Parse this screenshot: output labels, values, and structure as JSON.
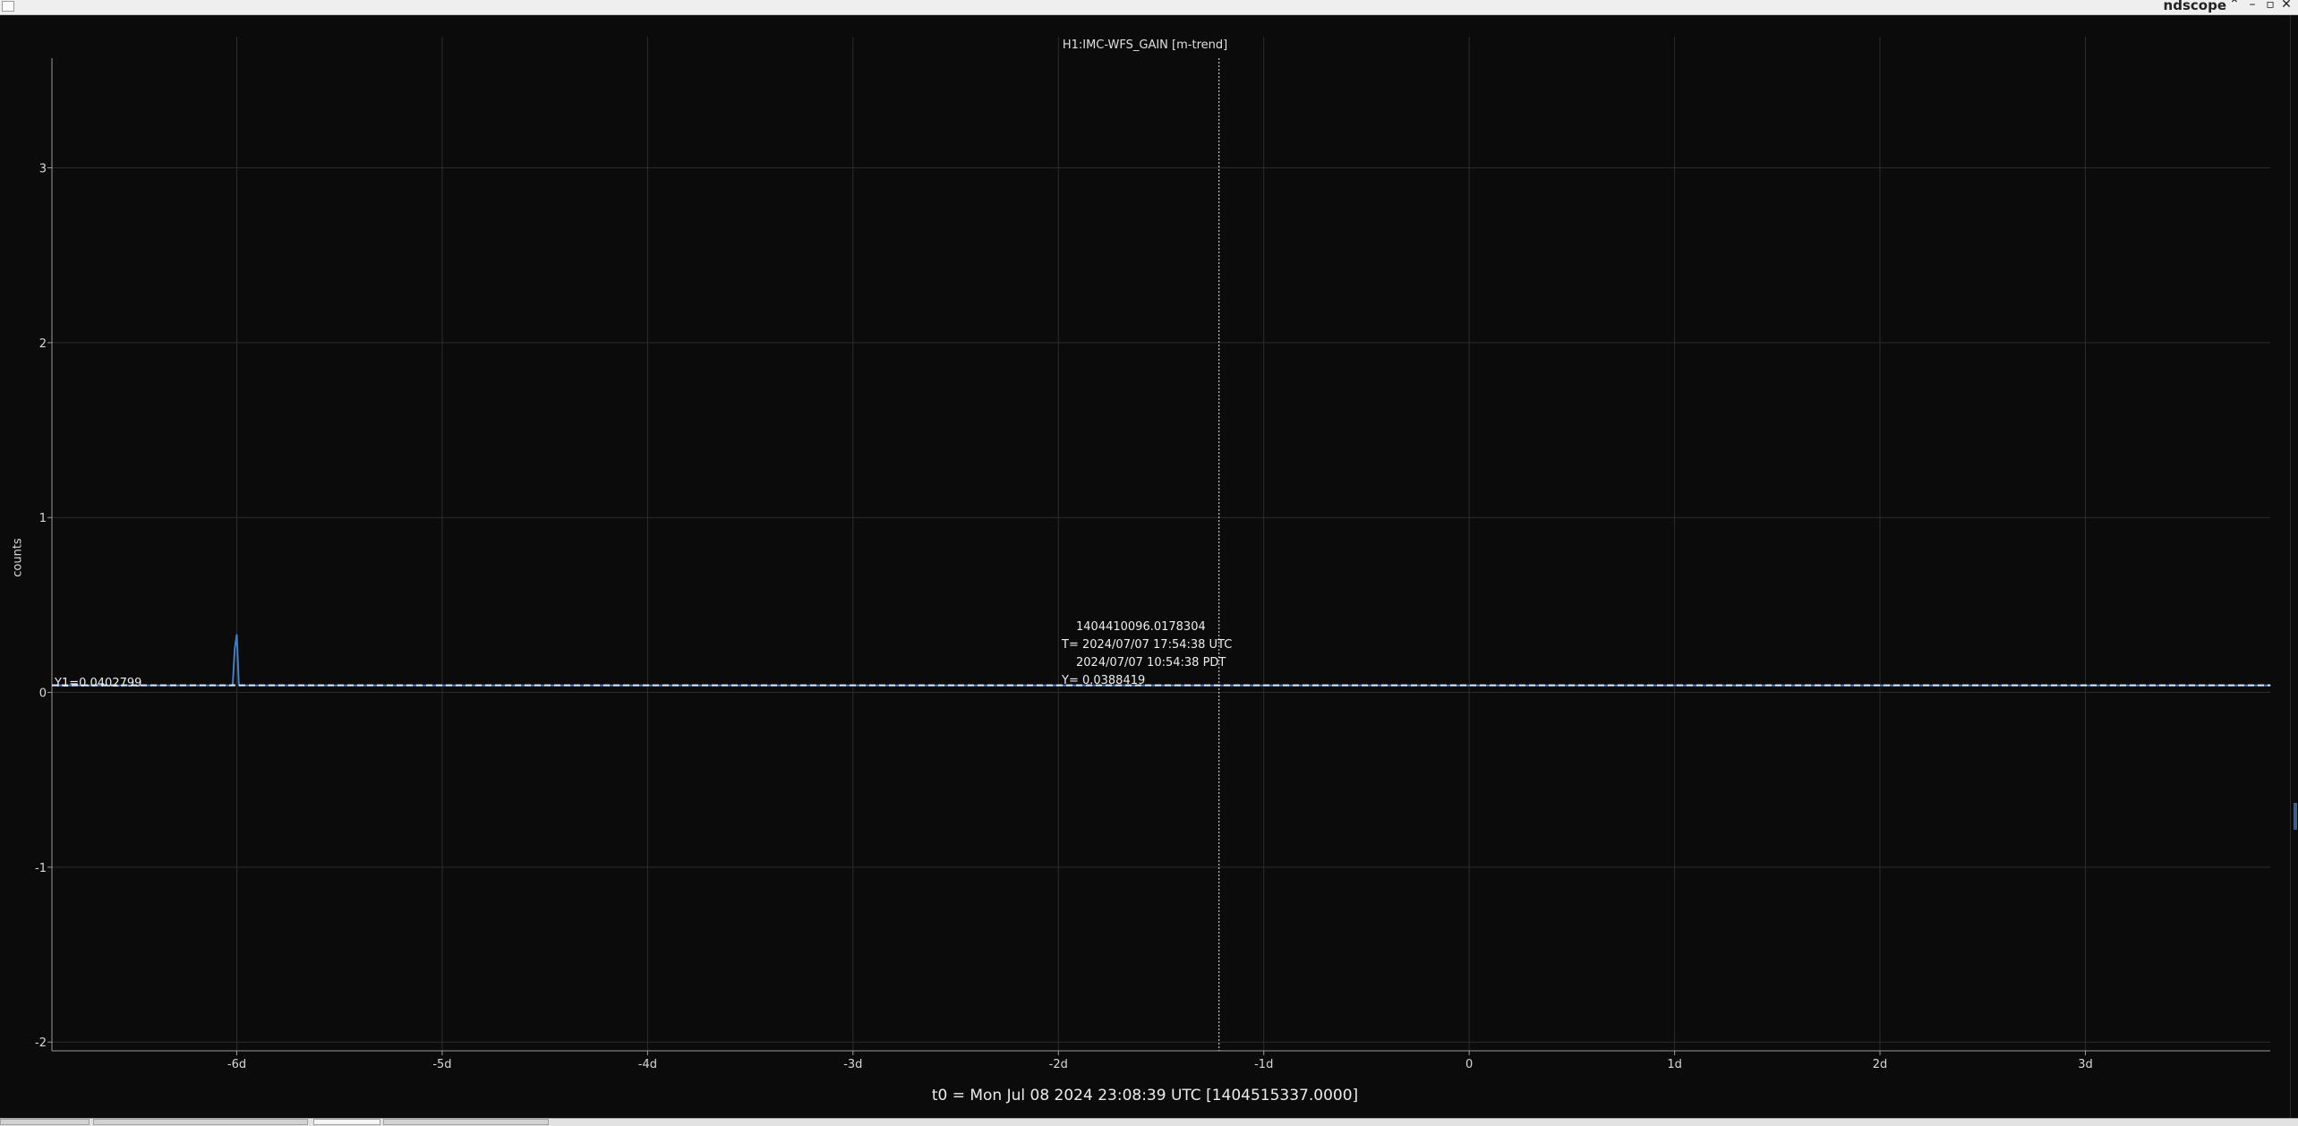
{
  "window": {
    "title": "ndscope",
    "buttons": [
      "⌃",
      "–",
      "▫",
      "✕"
    ]
  },
  "plot": {
    "title": "H1:IMC-WFS_GAIN [m-trend]",
    "t0": "t0 = Mon Jul 08 2024 23:08:39 UTC [1404515337.0000]",
    "cursor_y1": "Y1=0.0402799",
    "cursor_time": {
      "gps": "1404410096.0178304",
      "utc": "T= 2024/07/07 17:54:38 UTC",
      "pdt": "2024/07/07 10:54:38 PDT",
      "y": "Y= 0.0388419"
    }
  },
  "chart_data": {
    "type": "line",
    "title": "H1:IMC-WFS_GAIN [m-trend]",
    "xlabel": "t0 = Mon Jul 08 2024 23:08:39 UTC [1404515337.0000]",
    "ylabel": "counts",
    "xlim": [
      -6.9,
      3.9
    ],
    "ylim": [
      -2.05,
      3.75
    ],
    "x_ticks": [
      -6,
      -5,
      -4,
      -3,
      -2,
      -1,
      0,
      1,
      2,
      3
    ],
    "x_tick_labels": [
      "-6d",
      "-5d",
      "-4d",
      "-3d",
      "-2d",
      "-1d",
      "0",
      "1d",
      "2d",
      "3d"
    ],
    "y_ticks": [
      -2,
      -1,
      0,
      1,
      2,
      3
    ],
    "y_tick_labels": [
      "-2",
      "-1",
      "0",
      "1",
      "2",
      "3"
    ],
    "grid": true,
    "series": [
      {
        "color": "#3f7fc4",
        "x": [
          -6.9,
          -6.02,
          -6.01,
          -6.0,
          -5.99,
          3.9
        ],
        "y": [
          0.04,
          0.04,
          0.25,
          0.33,
          0.04,
          0.04
        ]
      }
    ],
    "cursors": {
      "y1": 0.0402799,
      "t_days": -1.218
    },
    "colors": {
      "background": "#0b0b0b",
      "trace": "#3f7fc4",
      "grid": "#2c2c2c",
      "cursor": "#e6e6e6"
    }
  }
}
